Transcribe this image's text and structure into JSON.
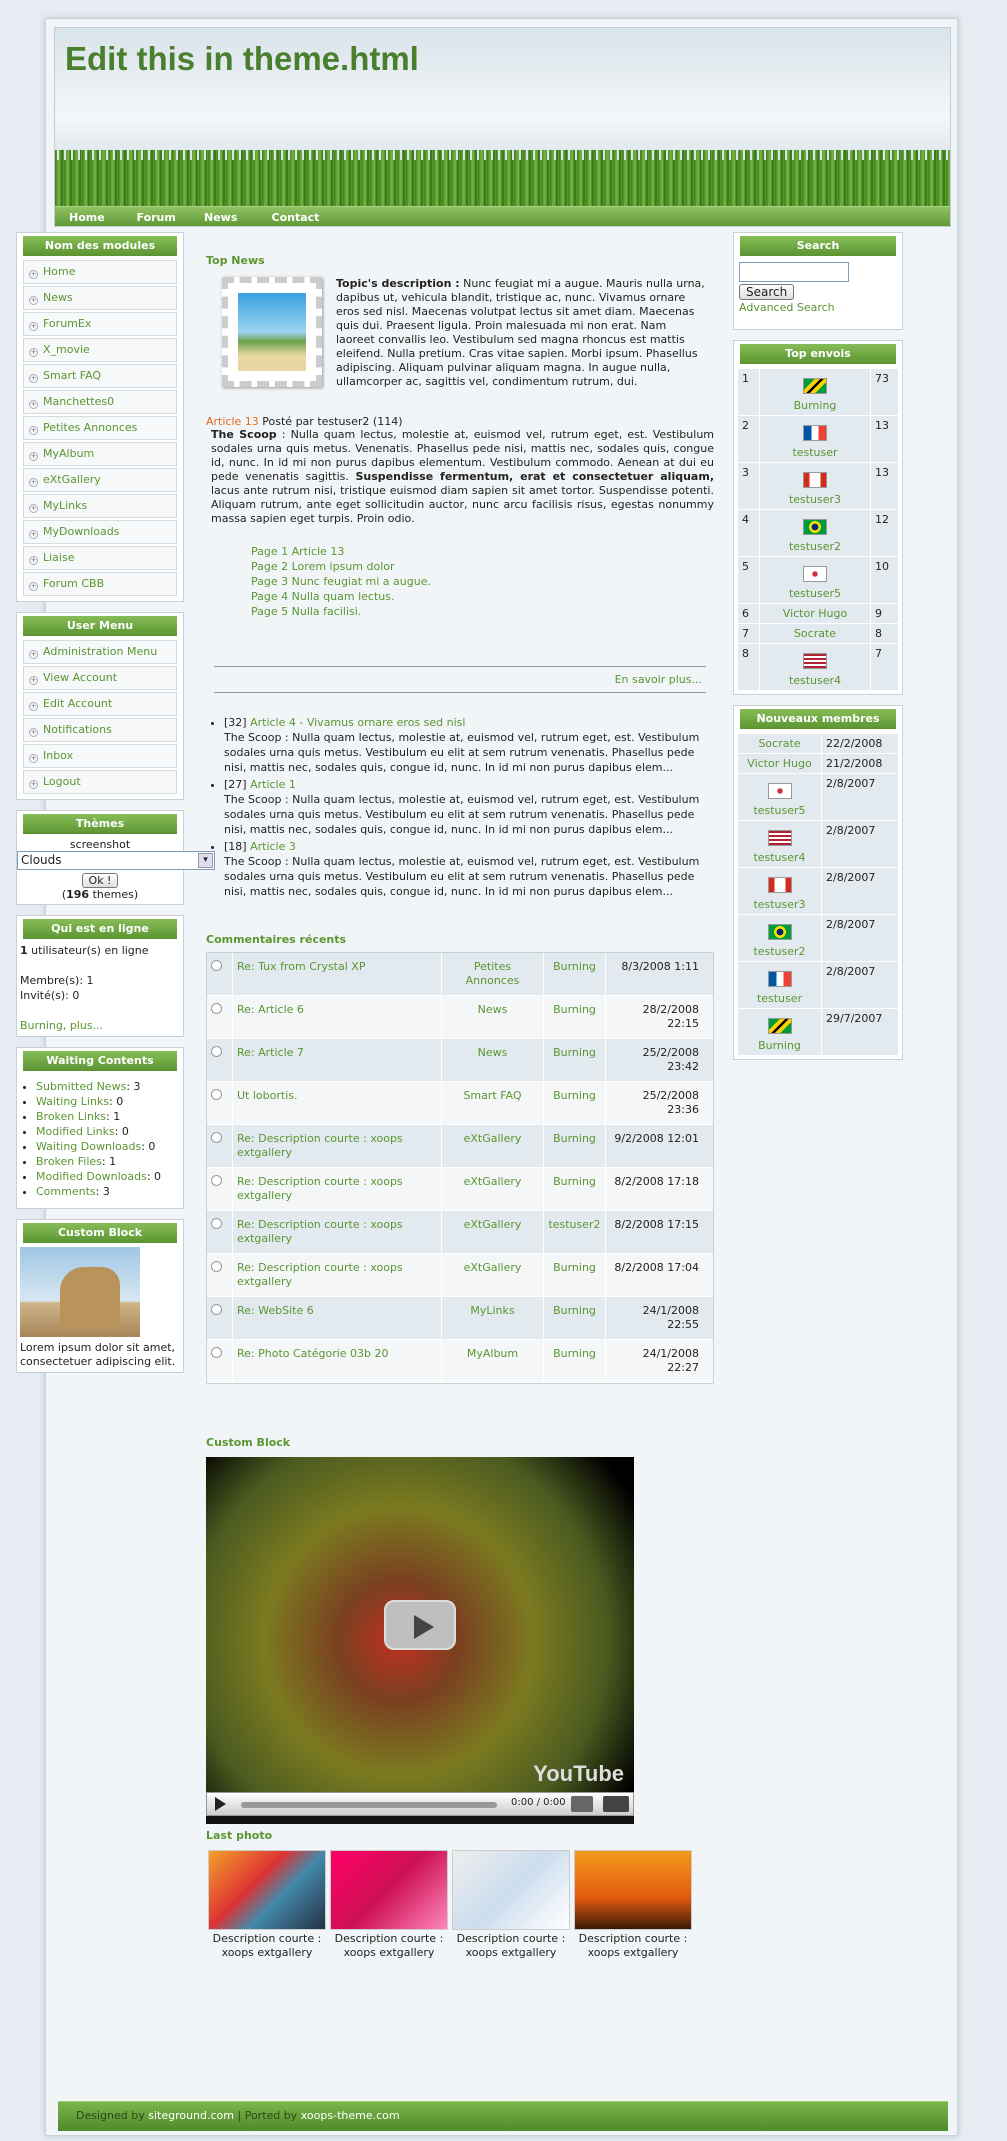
{
  "site": {
    "title": "Edit this in theme.html",
    "nav": [
      "Home",
      "Forum",
      "News",
      "Contact"
    ]
  },
  "left": {
    "modules": {
      "title": "Nom des modules",
      "items": [
        "Home",
        "News",
        "ForumEx",
        "X_movie",
        "Smart FAQ",
        "Manchettes0",
        "Petites Annonces",
        "MyAlbum",
        "eXtGallery",
        "MyLinks",
        "MyDownloads",
        "Liaise",
        "Forum CBB"
      ]
    },
    "usermenu": {
      "title": "User Menu",
      "items": [
        "Administration Menu",
        "View Account",
        "Edit Account",
        "Notifications",
        "Inbox",
        "Logout"
      ]
    },
    "themes": {
      "title": "Thèmes",
      "label": "screenshot",
      "selected": "Clouds",
      "button": "Ok !",
      "count": "196",
      "count_suffix": " themes)",
      "count_prefix": "("
    },
    "online": {
      "title": "Qui est en ligne",
      "users_count": "1",
      "users_text": " utilisateur(s) en ligne",
      "members": "Membre(s): 1",
      "guests": "Invité(s): 0",
      "names": "Burning, plus..."
    },
    "waiting": {
      "title": "Waiting Contents",
      "items": [
        {
          "label": "Submitted News",
          "value": "3"
        },
        {
          "label": "Waiting Links",
          "value": "0"
        },
        {
          "label": "Broken Links",
          "value": "1"
        },
        {
          "label": "Modified Links",
          "value": "0"
        },
        {
          "label": "Waiting Downloads",
          "value": "0"
        },
        {
          "label": "Broken Files",
          "value": "1"
        },
        {
          "label": "Modified Downloads",
          "value": "0"
        },
        {
          "label": "Comments",
          "value": "3"
        }
      ]
    },
    "custom": {
      "title": "Custom Block",
      "text": "Lorem ipsum dolor sit amet, consectetuer adipiscing elit."
    }
  },
  "center": {
    "topnews": {
      "title": "Top News",
      "desc_bold": "Topic's description :",
      "desc": " Nunc feugiat mi a augue. Mauris nulla urna, dapibus ut, vehicula blandit, tristique ac, nunc. Vivamus ornare eros sed nisl. Maecenas volutpat lectus sit amet diam. Maecenas quis dui. Praesent ligula. Proin malesuada mi non erat. Nam laoreet convallis leo. Vestibulum sed magna rhoncus est mattis eleifend. Nulla pretium. Cras vitae sapien. Morbi ipsum. Phasellus adipiscing. Aliquam pulvinar aliquam magna. In augue nulla, ullamcorper ac, sagittis vel, condimentum rutrum, dui.",
      "article_title": "Article 13",
      "article_meta": " Posté par testuser2 (114)",
      "scoop_bold": "The Scoop",
      "scoop": " : Nulla quam lectus, molestie at, euismod vel, rutrum eget, est. Vestibulum sodales urna quis metus. Venenatis. Phasellus pede nisi, mattis nec, sodales quis, congue id, nunc. In id mi non purus dapibus elementum. Vestibulum commodo. Aenean at dui eu pede venenatis sagittis. ",
      "scoop_bold2": "Suspendisse fermentum, erat et consectetuer aliquam,",
      "scoop2": " lacus ante rutrum nisi, tristique euismod diam sapien sit amet tortor. Suspendisse potenti. Aliquam rutrum, ante eget sollicitudin auctor, nunc arcu facilisis risus, egestas nonummy massa sapien eget turpis. Proin odio.",
      "pages": [
        "Page 1 Article 13",
        "Page 2 Lorem ipsum dolor",
        "Page 3 Nunc feugiat mi a augue.",
        "Page 4 Nulla quam lectus.",
        "Page 5 Nulla facilisi."
      ],
      "more": "En savoir plus...",
      "list": [
        {
          "num": "[32]",
          "title": "Article 4 - Vivamus ornare eros sed nisl",
          "text": "The Scoop : Nulla quam lectus, molestie at, euismod vel, rutrum eget, est. Vestibulum sodales urna quis metus. Vestibulum eu elit at sem rutrum venenatis. Phasellus pede nisi, mattis nec, sodales quis, congue id, nunc. In id mi non purus dapibus elem..."
        },
        {
          "num": "[27]",
          "title": "Article 1",
          "text": "The Scoop : Nulla quam lectus, molestie at, euismod vel, rutrum eget, est. Vestibulum sodales urna quis metus. Vestibulum eu elit at sem rutrum venenatis. Phasellus pede nisi, mattis nec, sodales quis, congue id, nunc. In id mi non purus dapibus elem..."
        },
        {
          "num": "[18]",
          "title": "Article 3",
          "text": "The Scoop : Nulla quam lectus, molestie at, euismod vel, rutrum eget, est. Vestibulum sodales urna quis metus. Vestibulum eu elit at sem rutrum venenatis. Phasellus pede nisi, mattis nec, sodales quis, congue id, nunc. In id mi non purus dapibus elem..."
        }
      ]
    },
    "comments": {
      "title": "Commentaires récents",
      "rows": [
        {
          "title": "Re: Tux from Crystal XP",
          "module": "Petites Annonces",
          "user": "Burning",
          "date": "8/3/2008 1:11"
        },
        {
          "title": "Re: Article 6",
          "module": "News",
          "user": "Burning",
          "date": "28/2/2008 22:15"
        },
        {
          "title": "Re: Article 7",
          "module": "News",
          "user": "Burning",
          "date": "25/2/2008 23:42"
        },
        {
          "title": "Ut lobortis.",
          "module": "Smart FAQ",
          "user": "Burning",
          "date": "25/2/2008 23:36"
        },
        {
          "title": "Re: Description courte : xoops extgallery",
          "module": "eXtGallery",
          "user": "Burning",
          "date": "9/2/2008 12:01"
        },
        {
          "title": "Re: Description courte : xoops extgallery",
          "module": "eXtGallery",
          "user": "Burning",
          "date": "8/2/2008 17:18"
        },
        {
          "title": "Re: Description courte : xoops extgallery",
          "module": "eXtGallery",
          "user": "testuser2",
          "date": "8/2/2008 17:15"
        },
        {
          "title": "Re: Description courte : xoops extgallery",
          "module": "eXtGallery",
          "user": "Burning",
          "date": "8/2/2008 17:04"
        },
        {
          "title": "Re: WebSite 6",
          "module": "MyLinks",
          "user": "Burning",
          "date": "24/1/2008 22:55"
        },
        {
          "title": "Re: Photo Catégorie 03b 20",
          "module": "MyAlbum",
          "user": "Burning",
          "date": "24/1/2008 22:27"
        }
      ]
    },
    "video": {
      "title": "Custom Block",
      "time": "0:00 / 0:00",
      "brand": "YouTube"
    },
    "lastphoto": {
      "title": "Last photo",
      "items": [
        "Description courte : xoops extgallery",
        "Description courte : xoops extgallery",
        "Description courte : xoops extgallery",
        "Description courte : xoops extgallery"
      ]
    }
  },
  "right": {
    "search": {
      "title": "Search",
      "button": "Search",
      "advanced": "Advanced Search"
    },
    "topenvois": {
      "title": "Top envois",
      "rows": [
        {
          "rank": "1",
          "name": "Burning",
          "count": "73",
          "flag": "jamaica"
        },
        {
          "rank": "2",
          "name": "testuser",
          "count": "13",
          "flag": "france"
        },
        {
          "rank": "3",
          "name": "testuser3",
          "count": "13",
          "flag": "canada"
        },
        {
          "rank": "4",
          "name": "testuser2",
          "count": "12",
          "flag": "brazil"
        },
        {
          "rank": "5",
          "name": "testuser5",
          "count": "10",
          "flag": "korea"
        },
        {
          "rank": "6",
          "name": "Victor Hugo",
          "count": "9",
          "flag": ""
        },
        {
          "rank": "7",
          "name": "Socrate",
          "count": "8",
          "flag": ""
        },
        {
          "rank": "8",
          "name": "testuser4",
          "count": "7",
          "flag": "usa"
        }
      ]
    },
    "newmembers": {
      "title": "Nouveaux membres",
      "rows": [
        {
          "name": "Socrate",
          "date": "22/2/2008",
          "flag": ""
        },
        {
          "name": "Victor Hugo",
          "date": "21/2/2008",
          "flag": ""
        },
        {
          "name": "testuser5",
          "date": "2/8/2007",
          "flag": "korea"
        },
        {
          "name": "testuser4",
          "date": "2/8/2007",
          "flag": "usa"
        },
        {
          "name": "testuser3",
          "date": "2/8/2007",
          "flag": "canada"
        },
        {
          "name": "testuser2",
          "date": "2/8/2007",
          "flag": "brazil"
        },
        {
          "name": "testuser",
          "date": "2/8/2007",
          "flag": "france"
        },
        {
          "name": "Burning",
          "date": "29/7/2007",
          "flag": "jamaica"
        }
      ]
    }
  },
  "footer": {
    "designed": "Designed by ",
    "designed_link": "siteground.com",
    "ported": " | Ported by ",
    "ported_link": "xoops-theme.com"
  }
}
